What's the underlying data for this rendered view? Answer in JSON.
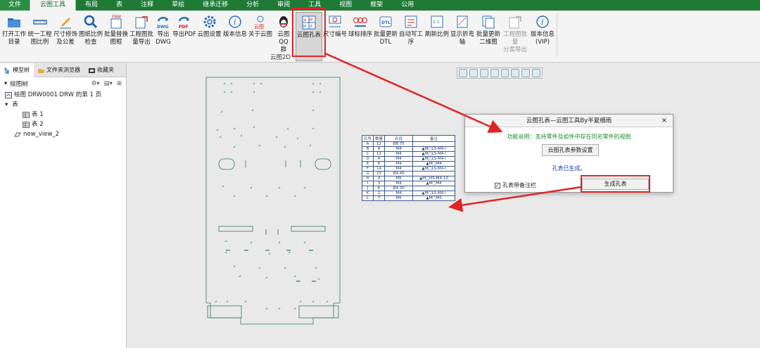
{
  "tabs": [
    "文件",
    "云图工具",
    "布局",
    "表",
    "注释",
    "草绘",
    "继承迁移",
    "分析",
    "审阅",
    "工具",
    "视图",
    "框架",
    "公用"
  ],
  "ribbon": {
    "group_label": "云图2D",
    "buttons": [
      {
        "label": "打开工作\n目录",
        "icon": "folder-icon"
      },
      {
        "label": "统一工程\n图比例",
        "icon": "ruler-icon"
      },
      {
        "label": "尺寸修饰\n及公差",
        "icon": "pen-icon"
      },
      {
        "label": "图纸比例\n检查",
        "icon": "magnifier-icon"
      },
      {
        "label": "批量替换\n图框",
        "icon": "frame-icon"
      },
      {
        "label": "工程图批\n量导出",
        "icon": "export-icon"
      },
      {
        "label": "导出\nDWG",
        "icon": "dwg-icon"
      },
      {
        "label": "导出PDF",
        "icon": "pdf-icon"
      },
      {
        "label": "云图设置",
        "icon": "gear-icon"
      },
      {
        "label": "版本信息",
        "icon": "info-icon"
      },
      {
        "label": "关于云图",
        "icon": "cloud-icon"
      },
      {
        "label": "云图QQ\n群",
        "icon": "qq-icon"
      },
      {
        "label": "云图孔表",
        "icon": "hole-table-icon"
      },
      {
        "label": "尺寸编号",
        "icon": "dimension-number-icon"
      },
      {
        "label": "球标排序",
        "icon": "balloon-icon"
      },
      {
        "label": "批量更新\nDTL",
        "icon": "dtl-icon"
      },
      {
        "label": "自动写工\n序",
        "icon": "process-icon"
      },
      {
        "label": "刷新比例",
        "icon": "refresh-scale-icon"
      },
      {
        "label": "显示折弯\n轴",
        "icon": "bend-axis-icon"
      },
      {
        "label": "批量更新\n二维图",
        "icon": "update-2d-icon"
      },
      {
        "label": "工程图批量\n分类导出",
        "icon": "classify-export-icon"
      },
      {
        "label": "版本信息\n(VIP)",
        "icon": "info-vip-icon"
      }
    ]
  },
  "left_panel": {
    "tabs": [
      "模型树",
      "文件夹浏览器",
      "收藏夹"
    ],
    "tree_title": "绘图树",
    "items": [
      {
        "label": "绘图 DRW0001.DRW 的第 1 页",
        "level": 0
      },
      {
        "label": "表",
        "level": 0
      },
      {
        "label": "表 1",
        "level": 2
      },
      {
        "label": "表 2",
        "level": 2
      },
      {
        "label": "new_view_2",
        "level": 1
      }
    ]
  },
  "hole_table": {
    "headers": [
      "孔号",
      "数量",
      "孔径",
      "备注"
    ],
    "rows": [
      [
        "A",
        "12",
        "Ø8.75",
        ""
      ],
      [
        "B",
        "8",
        "M4",
        "▲M□LS-M4-l"
      ],
      [
        "C",
        "12",
        "M4",
        "▲M□LS-M4-l"
      ],
      [
        "D",
        "4",
        "M4",
        "▲M□LS-M4-l"
      ],
      [
        "E",
        "6",
        "M4",
        "▲M□M4"
      ],
      [
        "F",
        "14",
        "M4",
        "▲M□LS-M4-l"
      ],
      [
        "G",
        "23",
        "Ø4.40",
        ""
      ],
      [
        "H",
        "4",
        "M5",
        "▲M□HS-M4-10"
      ],
      [
        "I",
        "3",
        "M4",
        "▲M□M4"
      ],
      [
        "J",
        "6",
        "Ø4.30",
        ""
      ],
      [
        "K",
        "2",
        "M4",
        "▲M□LS-M4-l"
      ],
      [
        "L",
        "7",
        "M5",
        "▲M□M5"
      ]
    ]
  },
  "dialog": {
    "title": "云图孔表—云图工具By半夏细雨",
    "close": "×",
    "description": "功能说明：支持零件及组件中存在同名零件的视图",
    "settings_button": "云图孔表参数设置",
    "status": "孔表已生成。",
    "checkbox_label": "孔表带备注栏",
    "checkbox_checked": true,
    "checkbox_mark": "✓",
    "generate_button": "生成孔表"
  },
  "colors": {
    "tab_bar": "#1f7a36",
    "highlight": "#e02424",
    "drawing_line": "#2f7a6b",
    "status_text": "#1a3fd0",
    "description_text": "#1d8a2c"
  }
}
